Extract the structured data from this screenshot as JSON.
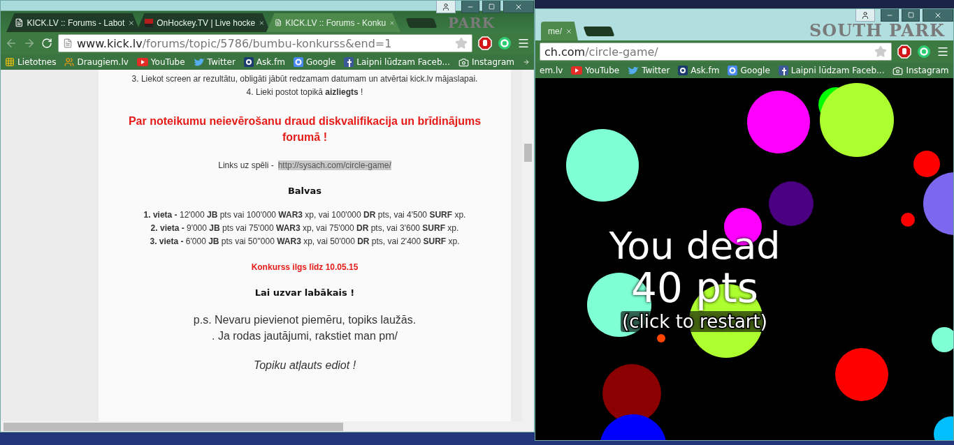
{
  "forum_window": {
    "tabs": [
      {
        "kind": "page",
        "title": "KICK.LV :: Forums - Labot",
        "selected": false
      },
      {
        "kind": "site",
        "title": "OnHockey.TV | Live hocke",
        "selected": false
      },
      {
        "kind": "page",
        "title": "KICK.LV :: Forums - Konku",
        "selected": true
      }
    ],
    "theme_text": "PARK",
    "address": {
      "host": "www.kick.lv",
      "path": "/forums/topic/5786/bumbu-konkurss&end=1"
    },
    "bookmarks": [
      {
        "kind": "apps",
        "label": "Lietotnes"
      },
      {
        "kind": "people",
        "label": "Draugiem.lv"
      },
      {
        "kind": "video",
        "label": "YouTube"
      },
      {
        "kind": "bird",
        "label": "Twitter"
      },
      {
        "kind": "tile",
        "label": "Ask.fm"
      },
      {
        "kind": "search",
        "label": "Google"
      },
      {
        "kind": "social",
        "label": "Laipni lūdzam Faceb..."
      },
      {
        "kind": "camera",
        "label": "Instagram"
      }
    ],
    "post": [
      {
        "kind": "text",
        "text": "3. Liekot screen ar rezultātu, obligāti jābūt redzamam datumam un atvērtai kick.lv mājaslapai."
      },
      {
        "kind": "text",
        "text": "4. Lieki postot topikā **aizliegts** !"
      },
      {
        "kind": "warning",
        "text": "Par noteikumu neievērošanu draud diskvalifikacija un brīdinājums forumā !"
      },
      {
        "kind": "link",
        "label": "Links uz spēli  -",
        "url": "http://sysach.com/circle-game/"
      },
      {
        "kind": "heading",
        "text": "Balvas"
      },
      {
        "kind": "prizes",
        "lines": [
          "**1. vieta -** 12'000 **JB** pts vai 100'000 **WAR3** xp, vai 100'000 **DR** pts, vai 4'500 **SURF** xp.",
          "**2. vieta -** 9'000 **JB** pts vai 75'000 **WAR3** xp, vai 75'000 **DR** pts, vai 3'600 **SURF** xp.",
          "**3. vieta -** 6'000 **JB** pts vai 50''000 **WAR3** xp, vai 50'000 **DR** pts, vai 2'400 **SURF** xp."
        ]
      },
      {
        "kind": "deadline",
        "text": "Konkurss ilgs līdz 10.05.15"
      },
      {
        "kind": "heading",
        "text": "Lai uzvar labākais !"
      },
      {
        "kind": "ps",
        "lines": [
          "p.s. Nevaru pievienot piemēru, topiks laužās.",
          ". Ja rodas jautājumi, rakstiet man pm/"
        ]
      },
      {
        "kind": "italic",
        "text": "Topiku atļauts ediot !"
      }
    ]
  },
  "game_window": {
    "tabs": [
      {
        "title": "me/",
        "selected": true
      }
    ],
    "theme_text": "SOUTH PARK",
    "address": {
      "host": "ch.com",
      "path": "/circle-game/"
    },
    "bookmarks": [
      {
        "kind": "plain",
        "label": "em.lv"
      },
      {
        "kind": "video",
        "label": "YouTube"
      },
      {
        "kind": "bird",
        "label": "Twitter"
      },
      {
        "kind": "tile",
        "label": "Ask.fm"
      },
      {
        "kind": "search",
        "label": "Google"
      },
      {
        "kind": "social",
        "label": "Laipni lūdzam Faceb..."
      },
      {
        "kind": "camera",
        "label": "Instagram"
      }
    ],
    "game": {
      "message": "You dead",
      "score": "40 pts",
      "hint": "(click to restart)"
    }
  }
}
